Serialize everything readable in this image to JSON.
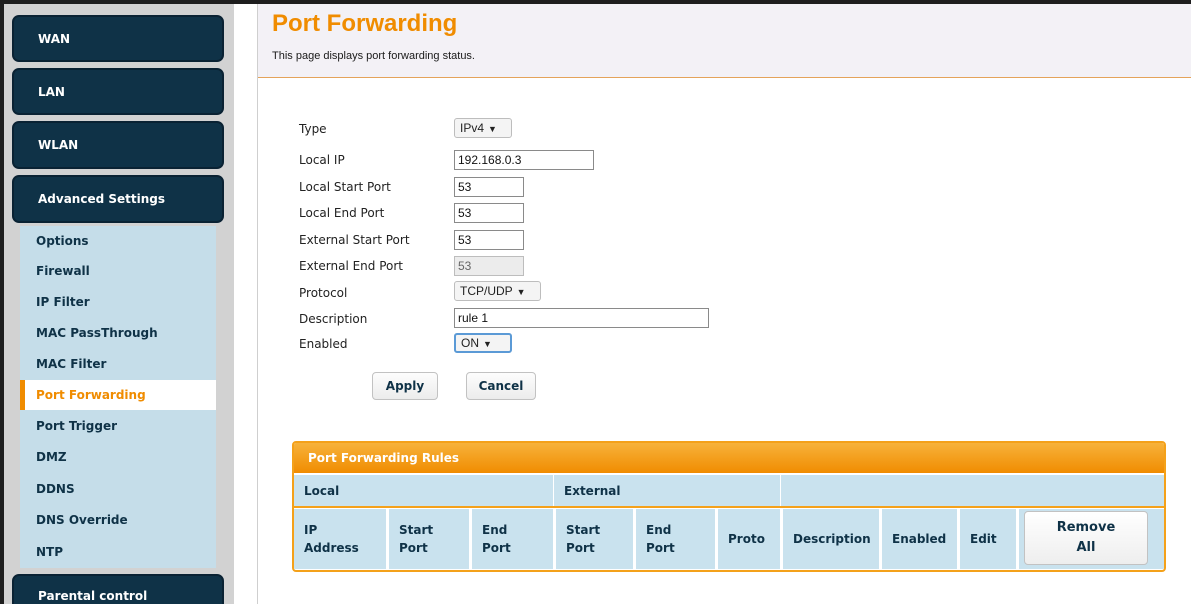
{
  "sidebar": {
    "nav": {
      "wan": "WAN",
      "lan": "LAN",
      "wlan": "WLAN",
      "advanced": "Advanced Settings",
      "parental": "Parental control"
    },
    "submenu": [
      {
        "label": "Options"
      },
      {
        "label": "Firewall"
      },
      {
        "label": "IP Filter"
      },
      {
        "label": "MAC PassThrough"
      },
      {
        "label": "MAC Filter"
      },
      {
        "label": "Port Forwarding",
        "active": true
      },
      {
        "label": "Port Trigger"
      },
      {
        "label": "DMZ"
      },
      {
        "label": "DDNS"
      },
      {
        "label": "DNS Override"
      },
      {
        "label": "NTP"
      }
    ]
  },
  "header": {
    "title": "Port Forwarding",
    "description": "This page displays port forwarding status."
  },
  "form": {
    "type": {
      "label": "Type",
      "value": "IPv4"
    },
    "local_ip": {
      "label": "Local IP",
      "value": "192.168.0.3"
    },
    "local_start_port": {
      "label": "Local Start Port",
      "value": "53"
    },
    "local_end_port": {
      "label": "Local End Port",
      "value": "53"
    },
    "external_start_port": {
      "label": "External Start Port",
      "value": "53"
    },
    "external_end_port": {
      "label": "External End Port",
      "value": "53"
    },
    "protocol": {
      "label": "Protocol",
      "value": "TCP/UDP"
    },
    "description": {
      "label": "Description",
      "value": "rule 1"
    },
    "enabled": {
      "label": "Enabled",
      "value": "ON"
    },
    "apply_label": "Apply",
    "cancel_label": "Cancel"
  },
  "rules_table": {
    "title": "Port Forwarding Rules",
    "groups": {
      "local": "Local",
      "external": "External"
    },
    "columns": {
      "ip_address": [
        "IP",
        "Address"
      ],
      "local_start": [
        "Start",
        "Port"
      ],
      "local_end": [
        "End",
        "Port"
      ],
      "ext_start": [
        "Start",
        "Port"
      ],
      "ext_end": [
        "End",
        "Port"
      ],
      "proto": "Proto",
      "description": "Description",
      "enabled": "Enabled",
      "edit": "Edit"
    },
    "remove_all": [
      "Remove",
      "All"
    ]
  },
  "colors": {
    "accent": "#f08c00",
    "nav_dark": "#0f3247",
    "submenu_bg": "#c5dde9",
    "table_header_bg": "#c9e2ee"
  },
  "icons": {
    "dropdown": "caret-down-icon"
  }
}
